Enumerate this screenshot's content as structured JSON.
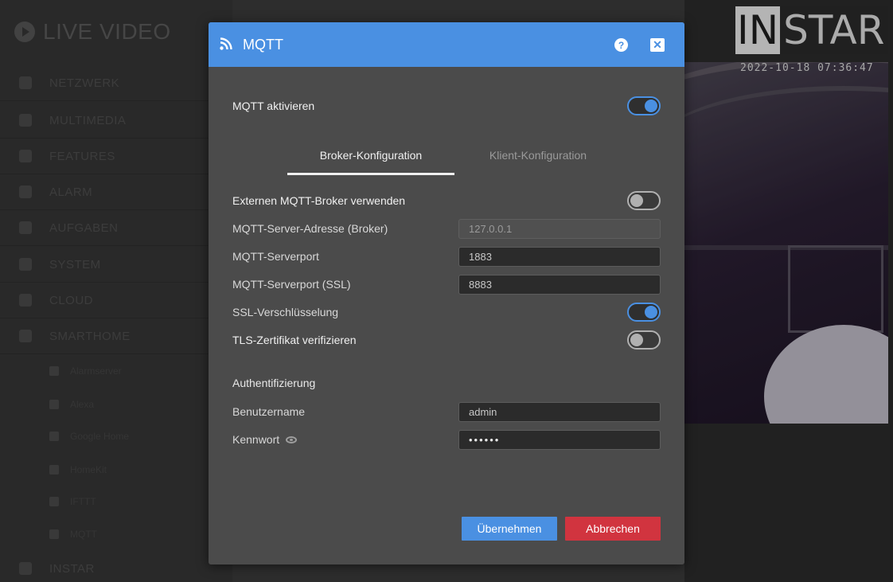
{
  "background": {
    "sidebar": {
      "title": "LIVE VIDEO",
      "items": [
        {
          "label": "NETZWERK",
          "icon": "network-icon"
        },
        {
          "label": "MULTIMEDIA",
          "icon": "image-icon"
        },
        {
          "label": "FEATURES",
          "icon": "features-icon"
        },
        {
          "label": "ALARM",
          "icon": "bell-icon"
        },
        {
          "label": "AUFGABEN",
          "icon": "calendar-icon"
        },
        {
          "label": "SYSTEM",
          "icon": "gear-icon"
        },
        {
          "label": "CLOUD",
          "icon": "cloud-icon"
        },
        {
          "label": "SMARTHOME",
          "icon": "smarthome-icon"
        }
      ],
      "subitems": [
        {
          "label": "Alarmserver",
          "icon": "server-icon"
        },
        {
          "label": "Alexa",
          "icon": "chat-icon"
        },
        {
          "label": "Google Home",
          "icon": "google-icon"
        },
        {
          "label": "HomeKit",
          "icon": "home-icon"
        },
        {
          "label": "IFTTT",
          "icon": "ifttt-icon"
        },
        {
          "label": "MQTT",
          "icon": "rss-icon"
        }
      ],
      "bottom_item": {
        "label": "INSTAR",
        "icon": "star-icon"
      }
    },
    "video": {
      "brand_in": "IN",
      "brand_star": "STAR",
      "timestamp": "2022-10-18 07:36:47"
    }
  },
  "modal": {
    "title": "MQTT",
    "help_symbol": "?",
    "close_symbol": "✕",
    "mqtt_enable": {
      "label": "MQTT aktivieren",
      "state": "on"
    },
    "tabs": [
      {
        "label": "Broker-Konfiguration",
        "active": true
      },
      {
        "label": "Klient-Konfiguration",
        "active": false
      }
    ],
    "external_broker": {
      "label": "Externen MQTT-Broker verwenden",
      "state": "off"
    },
    "server_address": {
      "label": "MQTT-Server-Adresse (Broker)",
      "value": "127.0.0.1",
      "disabled": true
    },
    "server_port": {
      "label": "MQTT-Serverport",
      "value": "1883"
    },
    "server_port_ssl": {
      "label": "MQTT-Serverport (SSL)",
      "value": "8883"
    },
    "ssl": {
      "label": "SSL-Verschlüsselung",
      "state": "on"
    },
    "tls_verify": {
      "label": "TLS-Zertifikat verifizieren",
      "state": "off"
    },
    "auth_title": "Authentifizierung",
    "username": {
      "label": "Benutzername",
      "value": "admin"
    },
    "password": {
      "label": "Kennwort",
      "value": "••••••"
    },
    "buttons": {
      "apply": "Übernehmen",
      "cancel": "Abbrechen"
    }
  },
  "colors": {
    "accent": "#4a90e2",
    "danger": "#d1343f",
    "modal_bg": "#4b4b4b"
  }
}
